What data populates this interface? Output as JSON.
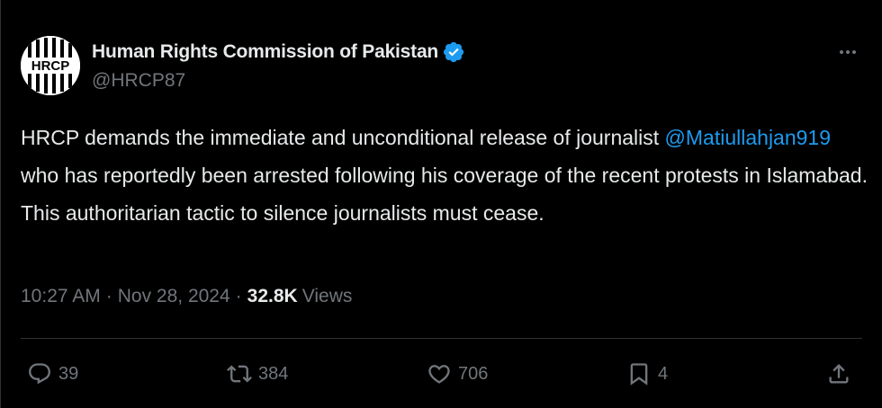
{
  "author": {
    "display_name": "Human Rights Commission of Pakistan",
    "handle": "@HRCP87",
    "avatar_text": "HRCP",
    "verified": true
  },
  "tweet": {
    "text_part1": "HRCP demands the immediate and unconditional release of journalist ",
    "mention": "@Matiullahjan919",
    "text_part2": " who has reportedly been arrested following his coverage of the recent protests in Islamabad. This authoritarian tactic to silence journalists must cease.",
    "time": "10:27 AM",
    "date": "Nov 28, 2024",
    "views_count": "32.8K",
    "views_label": "Views",
    "separator": "·"
  },
  "actions": {
    "replies": "39",
    "reposts": "384",
    "likes": "706",
    "bookmarks": "4"
  },
  "icons": {
    "more": "more-icon",
    "verified": "verified-badge-icon",
    "reply": "reply-icon",
    "repost": "repost-icon",
    "like": "like-icon",
    "bookmark": "bookmark-icon",
    "share": "share-icon"
  },
  "colors": {
    "background": "#000000",
    "text": "#e7e9ea",
    "muted": "#71767b",
    "accent": "#1d9bf0",
    "divider": "#2f3336"
  }
}
